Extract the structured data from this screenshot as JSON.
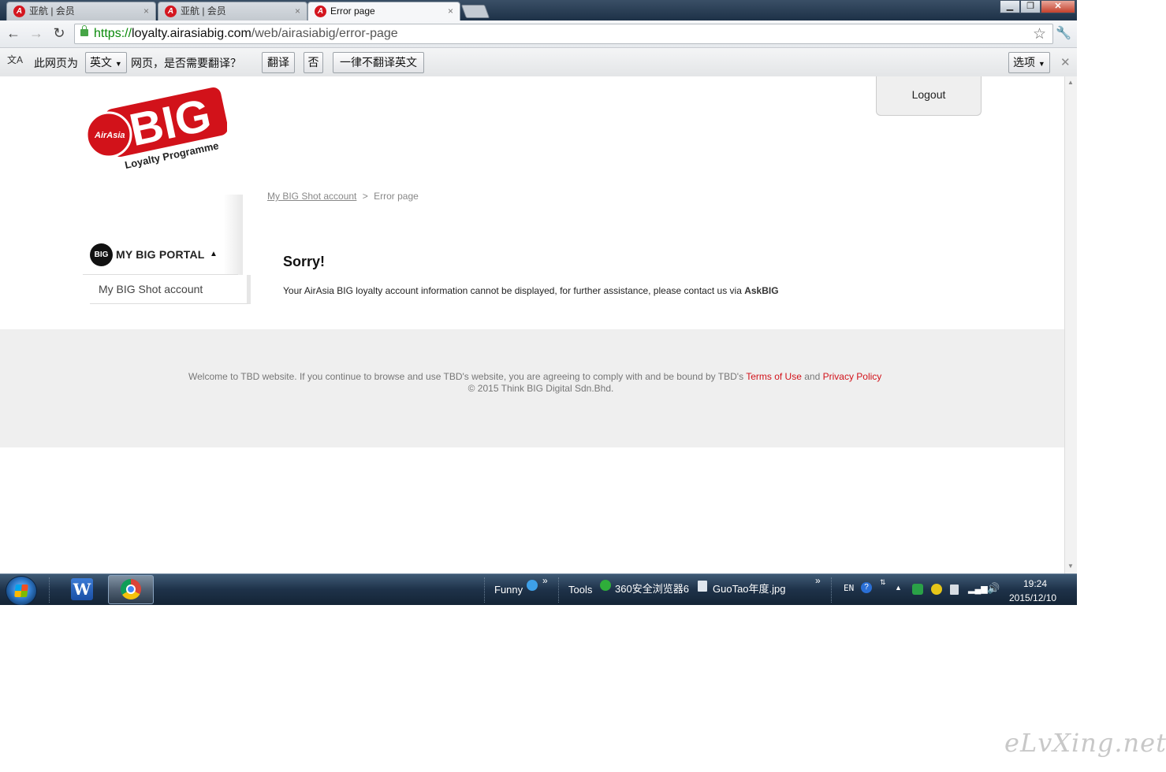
{
  "tabs": [
    {
      "title": "亚航 | 会员",
      "close": "×",
      "active": false
    },
    {
      "title": "亚航 | 会员",
      "close": "×",
      "active": false
    },
    {
      "title": "Error page",
      "close": "×",
      "active": true
    }
  ],
  "tab_favicon_glyph": "A",
  "window_controls": {
    "minimize": "▁",
    "maximize": "❐",
    "close": "✕"
  },
  "toolbar": {
    "back": "←",
    "forward": "→",
    "reload": "↻",
    "url_scheme": "https://",
    "url_host": "loyalty.airasiabig.com",
    "url_path": "/web/airasiabig/error-page",
    "star": "☆",
    "wrench": "🔧"
  },
  "translate_bar": {
    "icon": "文A",
    "prefix": "此网页为",
    "language": "英文",
    "suffix": "网页，是否需要翻译？",
    "translate_button": "翻译",
    "no_button": "否",
    "never_button": "一律不翻译英文",
    "options_button": "选项",
    "close": "✕"
  },
  "page": {
    "logout": "Logout",
    "logo": {
      "brand": "BIG",
      "circle": "AirAsia",
      "tagline": "Loyalty Programme"
    },
    "breadcrumb": {
      "link": "My BIG Shot account",
      "separator": ">",
      "current": "Error page"
    },
    "sidebar": {
      "badge": "BIG",
      "header": "MY BIG PORTAL",
      "caret": "▲",
      "items": [
        {
          "label": "My BIG Shot account"
        }
      ]
    },
    "error": {
      "title": "Sorry!",
      "message": "Your AirAsia BIG loyalty account information cannot be displayed, for further assistance, please contact us via",
      "link": "AskBIG"
    },
    "footer": {
      "line1_prefix": "Welcome to TBD website. If you continue to browse and use TBD's website, you are agreeing to comply with and be bound by TBD's",
      "terms": "Terms of Use",
      "and": "and",
      "privacy": "Privacy Policy",
      "copyright": "© 2015 Think BIG Digital Sdn.Bhd."
    }
  },
  "taskbar": {
    "word_glyph": "W",
    "funny": "Funny",
    "tools": "Tools",
    "browser360": "360安全浏览器6",
    "file": "GuoTao年度.jpg",
    "lang": "EN",
    "time": "19:24",
    "date": "2015/12/10"
  },
  "watermark": "eLvXing.net",
  "colors": {
    "brand_red": "#d2121a",
    "taskbar": "#1e3249"
  }
}
